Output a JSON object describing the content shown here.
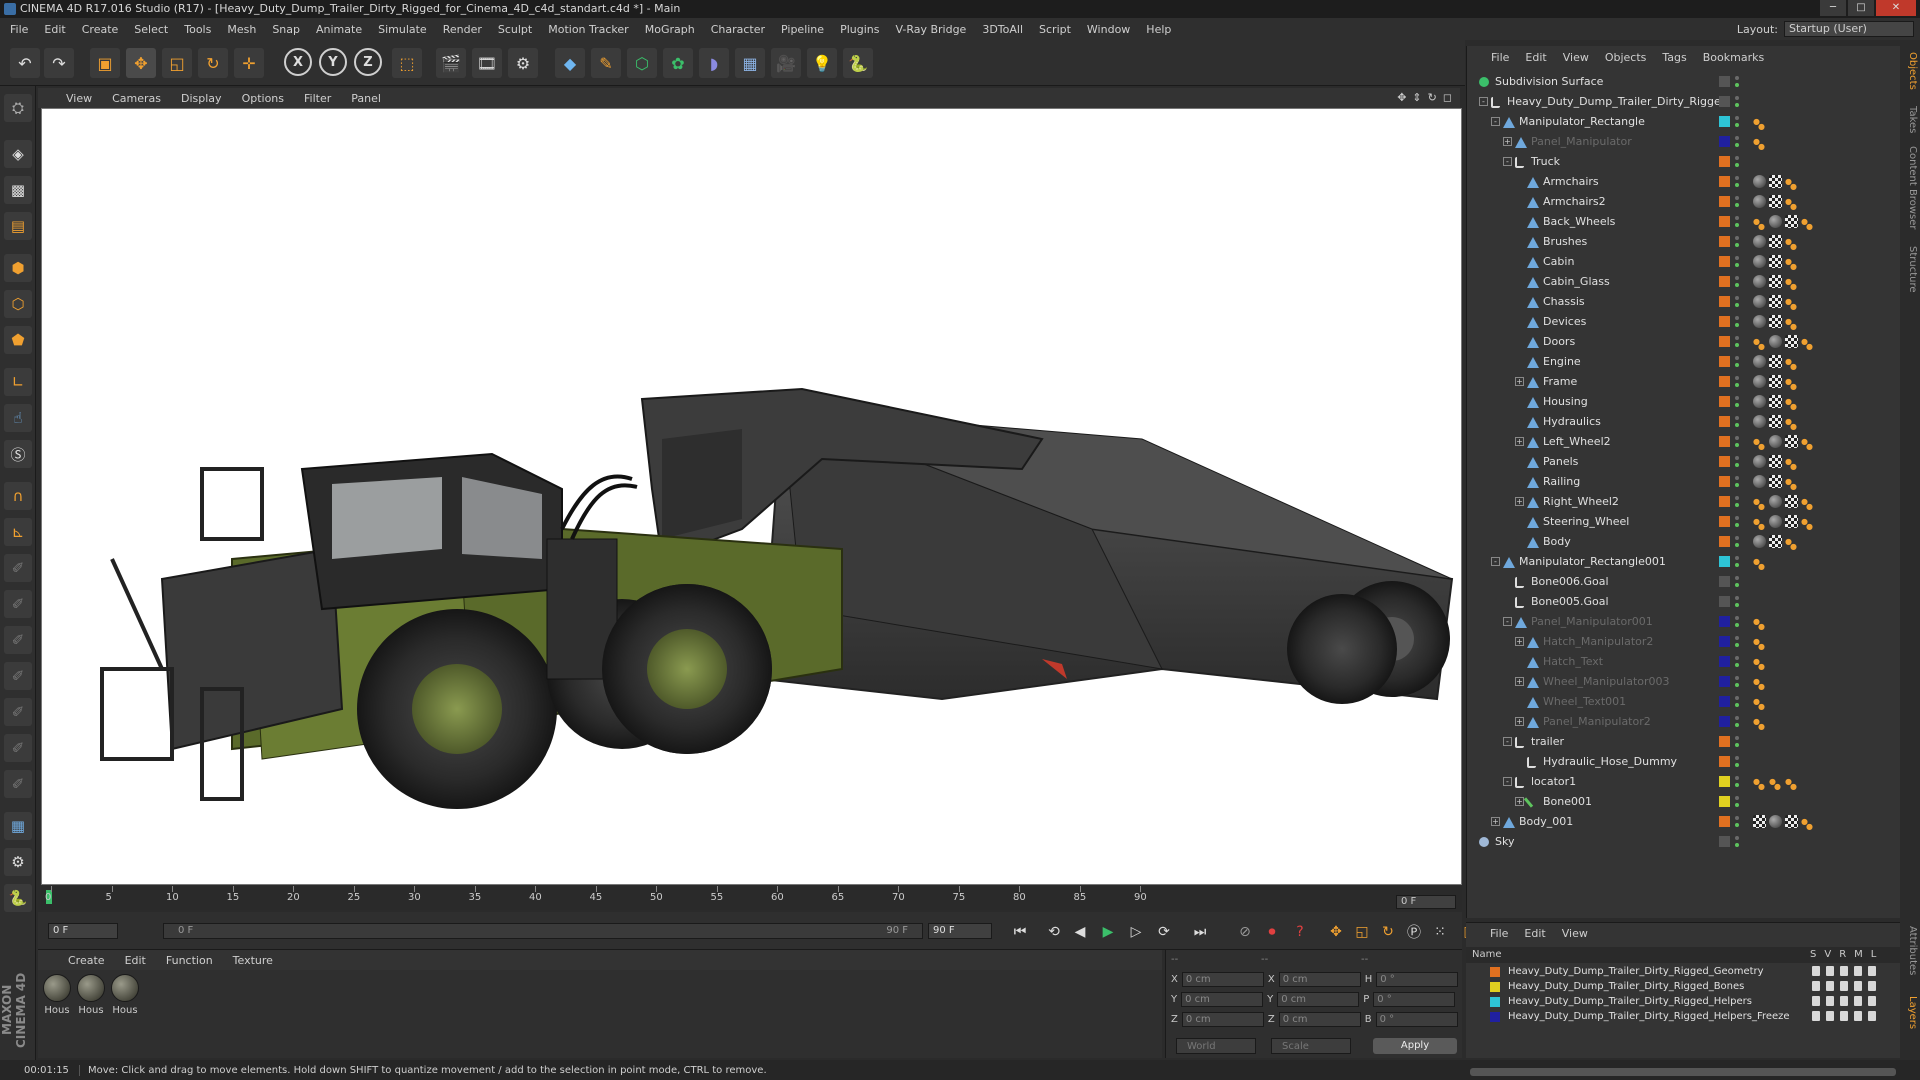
{
  "window": {
    "title": "CINEMA 4D R17.016 Studio (R17) - [Heavy_Duty_Dump_Trailer_Dirty_Rigged_for_Cinema_4D_c4d_standart.c4d *] - Main"
  },
  "menubar": {
    "items": [
      "File",
      "Edit",
      "Create",
      "Select",
      "Tools",
      "Mesh",
      "Snap",
      "Animate",
      "Simulate",
      "Render",
      "Sculpt",
      "Motion Tracker",
      "MoGraph",
      "Character",
      "Pipeline",
      "Plugins",
      "V-Ray Bridge",
      "3DToAll",
      "Script",
      "Window",
      "Help"
    ],
    "layout_label": "Layout:",
    "layout_value": "Startup (User)"
  },
  "toolbar": {
    "axis_x": "X",
    "axis_y": "Y",
    "axis_z": "Z"
  },
  "viewport": {
    "menu": [
      "View",
      "Cameras",
      "Display",
      "Options",
      "Filter",
      "Panel"
    ]
  },
  "timeline": {
    "ticks": [
      "0",
      "5",
      "10",
      "15",
      "20",
      "25",
      "30",
      "35",
      "40",
      "45",
      "50",
      "55",
      "60",
      "65",
      "70",
      "75",
      "80",
      "85",
      "90"
    ],
    "current_frame": "0 F"
  },
  "playback": {
    "start_field": "0 F",
    "slider_left": "0 F",
    "slider_right": "90 F",
    "end_field": "90 F"
  },
  "materials": {
    "menu": [
      "Create",
      "Edit",
      "Function",
      "Texture"
    ],
    "items": [
      "Hous",
      "Hous",
      "Hous"
    ]
  },
  "coordinates": {
    "header_left": "--",
    "header_mid": "--",
    "header_right": "--",
    "rows": [
      {
        "a_label": "X",
        "a_val": "0 cm",
        "b_label": "X",
        "b_val": "0 cm",
        "c_label": "H",
        "c_val": "0 °"
      },
      {
        "a_label": "Y",
        "a_val": "0 cm",
        "b_label": "Y",
        "b_val": "0 cm",
        "c_label": "P",
        "c_val": "0 °"
      },
      {
        "a_label": "Z",
        "a_val": "0 cm",
        "b_label": "Z",
        "b_val": "0 cm",
        "c_label": "B",
        "c_val": "0 °"
      }
    ],
    "world": "World",
    "scale": "Scale",
    "apply": "Apply"
  },
  "statusbar": {
    "time": "00:01:15",
    "message": "Move: Click and drag to move elements. Hold down SHIFT to quantize movement / add to the selection in point mode, CTRL to remove."
  },
  "object_manager": {
    "menu": [
      "File",
      "Edit",
      "View",
      "Objects",
      "Tags",
      "Bookmarks"
    ],
    "rows": [
      {
        "name": "Subdivision Surface",
        "depth": 0,
        "icon": "sub",
        "exp": "",
        "layer": "",
        "dim": false,
        "tags": []
      },
      {
        "name": "Heavy_Duty_Dump_Trailer_Dirty_Rigged",
        "depth": 1,
        "icon": "null",
        "exp": "-",
        "layer": "",
        "dim": false,
        "tags": []
      },
      {
        "name": "Manipulator_Rectangle",
        "depth": 2,
        "icon": "poly",
        "exp": "-",
        "layer": "#2ec4d6",
        "dim": false,
        "tags": [
          "dot"
        ]
      },
      {
        "name": "Panel_Manipulator",
        "depth": 3,
        "icon": "poly",
        "exp": "+",
        "layer": "#2020a0",
        "dim": true,
        "tags": [
          "dot"
        ]
      },
      {
        "name": "Truck",
        "depth": 3,
        "icon": "null",
        "exp": "-",
        "layer": "#e07020",
        "dim": false,
        "tags": []
      },
      {
        "name": "Armchairs",
        "depth": 4,
        "icon": "poly",
        "exp": "",
        "layer": "#e07020",
        "dim": false,
        "tags": [
          "mat",
          "chk",
          "dot"
        ]
      },
      {
        "name": "Armchairs2",
        "depth": 4,
        "icon": "poly",
        "exp": "",
        "layer": "#e07020",
        "dim": false,
        "tags": [
          "mat",
          "chk",
          "dot"
        ]
      },
      {
        "name": "Back_Wheels",
        "depth": 4,
        "icon": "poly",
        "exp": "",
        "layer": "#e07020",
        "dim": false,
        "tags": [
          "dot",
          "mat",
          "chk",
          "dot"
        ]
      },
      {
        "name": "Brushes",
        "depth": 4,
        "icon": "poly",
        "exp": "",
        "layer": "#e07020",
        "dim": false,
        "tags": [
          "mat",
          "chk",
          "dot"
        ]
      },
      {
        "name": "Cabin",
        "depth": 4,
        "icon": "poly",
        "exp": "",
        "layer": "#e07020",
        "dim": false,
        "tags": [
          "mat",
          "chk",
          "dot"
        ]
      },
      {
        "name": "Cabin_Glass",
        "depth": 4,
        "icon": "poly",
        "exp": "",
        "layer": "#e07020",
        "dim": false,
        "tags": [
          "mat",
          "chk",
          "dot"
        ]
      },
      {
        "name": "Chassis",
        "depth": 4,
        "icon": "poly",
        "exp": "",
        "layer": "#e07020",
        "dim": false,
        "tags": [
          "mat",
          "chk",
          "dot"
        ]
      },
      {
        "name": "Devices",
        "depth": 4,
        "icon": "poly",
        "exp": "",
        "layer": "#e07020",
        "dim": false,
        "tags": [
          "mat",
          "chk",
          "dot"
        ]
      },
      {
        "name": "Doors",
        "depth": 4,
        "icon": "poly",
        "exp": "",
        "layer": "#e07020",
        "dim": false,
        "tags": [
          "dot",
          "mat",
          "chk",
          "dot"
        ]
      },
      {
        "name": "Engine",
        "depth": 4,
        "icon": "poly",
        "exp": "",
        "layer": "#e07020",
        "dim": false,
        "tags": [
          "mat",
          "chk",
          "dot"
        ]
      },
      {
        "name": "Frame",
        "depth": 4,
        "icon": "poly",
        "exp": "+",
        "layer": "#e07020",
        "dim": false,
        "tags": [
          "mat",
          "chk",
          "dot"
        ]
      },
      {
        "name": "Housing",
        "depth": 4,
        "icon": "poly",
        "exp": "",
        "layer": "#e07020",
        "dim": false,
        "tags": [
          "mat",
          "chk",
          "dot"
        ]
      },
      {
        "name": "Hydraulics",
        "depth": 4,
        "icon": "poly",
        "exp": "",
        "layer": "#e07020",
        "dim": false,
        "tags": [
          "mat",
          "chk",
          "dot"
        ]
      },
      {
        "name": "Left_Wheel2",
        "depth": 4,
        "icon": "poly",
        "exp": "+",
        "layer": "#e07020",
        "dim": false,
        "tags": [
          "dot",
          "mat",
          "chk",
          "dot"
        ]
      },
      {
        "name": "Panels",
        "depth": 4,
        "icon": "poly",
        "exp": "",
        "layer": "#e07020",
        "dim": false,
        "tags": [
          "mat",
          "chk",
          "dot"
        ]
      },
      {
        "name": "Railing",
        "depth": 4,
        "icon": "poly",
        "exp": "",
        "layer": "#e07020",
        "dim": false,
        "tags": [
          "mat",
          "chk",
          "dot"
        ]
      },
      {
        "name": "Right_Wheel2",
        "depth": 4,
        "icon": "poly",
        "exp": "+",
        "layer": "#e07020",
        "dim": false,
        "tags": [
          "dot",
          "mat",
          "chk",
          "dot"
        ]
      },
      {
        "name": "Steering_Wheel",
        "depth": 4,
        "icon": "poly",
        "exp": "",
        "layer": "#e07020",
        "dim": false,
        "tags": [
          "dot",
          "mat",
          "chk",
          "dot"
        ]
      },
      {
        "name": "Body",
        "depth": 4,
        "icon": "poly",
        "exp": "",
        "layer": "#e07020",
        "dim": false,
        "tags": [
          "mat",
          "chk",
          "dot"
        ]
      },
      {
        "name": "Manipulator_Rectangle001",
        "depth": 2,
        "icon": "poly",
        "exp": "-",
        "layer": "#2ec4d6",
        "dim": false,
        "tags": [
          "dot"
        ]
      },
      {
        "name": "Bone006.Goal",
        "depth": 3,
        "icon": "null",
        "exp": "",
        "layer": "",
        "dim": false,
        "tags": []
      },
      {
        "name": "Bone005.Goal",
        "depth": 3,
        "icon": "null",
        "exp": "",
        "layer": "",
        "dim": false,
        "tags": []
      },
      {
        "name": "Panel_Manipulator001",
        "depth": 3,
        "icon": "poly",
        "exp": "-",
        "layer": "#2020a0",
        "dim": true,
        "tags": [
          "dot"
        ]
      },
      {
        "name": "Hatch_Manipulator2",
        "depth": 4,
        "icon": "poly",
        "exp": "+",
        "layer": "#2020a0",
        "dim": true,
        "tags": [
          "dot"
        ]
      },
      {
        "name": "Hatch_Text",
        "depth": 4,
        "icon": "poly",
        "exp": "",
        "layer": "#2020a0",
        "dim": true,
        "tags": [
          "dot"
        ]
      },
      {
        "name": "Wheel_Manipulator003",
        "depth": 4,
        "icon": "poly",
        "exp": "+",
        "layer": "#2020a0",
        "dim": true,
        "tags": [
          "dot"
        ]
      },
      {
        "name": "Wheel_Text001",
        "depth": 4,
        "icon": "poly",
        "exp": "",
        "layer": "#2020a0",
        "dim": true,
        "tags": [
          "dot"
        ]
      },
      {
        "name": "Panel_Manipulator2",
        "depth": 4,
        "icon": "poly",
        "exp": "+",
        "layer": "#2020a0",
        "dim": true,
        "tags": [
          "dot"
        ]
      },
      {
        "name": "trailer",
        "depth": 3,
        "icon": "null",
        "exp": "-",
        "layer": "#e07020",
        "dim": false,
        "tags": []
      },
      {
        "name": "Hydraulic_Hose_Dummy",
        "depth": 4,
        "icon": "null",
        "exp": "",
        "layer": "#e07020",
        "dim": false,
        "tags": []
      },
      {
        "name": "locator1",
        "depth": 3,
        "icon": "null",
        "exp": "-",
        "layer": "#e0d020",
        "dim": false,
        "tags": [
          "dot",
          "dot",
          "dot"
        ]
      },
      {
        "name": "Bone001",
        "depth": 4,
        "icon": "bone",
        "exp": "+",
        "layer": "#e0d020",
        "dim": false,
        "tags": []
      },
      {
        "name": "Body_001",
        "depth": 2,
        "icon": "poly",
        "exp": "+",
        "layer": "#e07020",
        "dim": false,
        "tags": [
          "chk",
          "mat",
          "chk",
          "dot"
        ]
      },
      {
        "name": "Sky",
        "depth": 0,
        "icon": "sky",
        "exp": "",
        "layer": "",
        "dim": false,
        "tags": []
      }
    ]
  },
  "side_tabs": [
    "Objects",
    "Takes",
    "Content Browser",
    "Structure"
  ],
  "side_tabs_lower": [
    "Attributes",
    "Layers"
  ],
  "layer_manager": {
    "menu": [
      "File",
      "Edit",
      "View"
    ],
    "header_name": "Name",
    "header_flags": [
      "S",
      "V",
      "R",
      "M",
      "L"
    ],
    "layers": [
      {
        "name": "Heavy_Duty_Dump_Trailer_Dirty_Rigged_Geometry",
        "color": "#e07020"
      },
      {
        "name": "Heavy_Duty_Dump_Trailer_Dirty_Rigged_Bones",
        "color": "#e0d020"
      },
      {
        "name": "Heavy_Duty_Dump_Trailer_Dirty_Rigged_Helpers",
        "color": "#2ec4d6"
      },
      {
        "name": "Heavy_Duty_Dump_Trailer_Dirty_Rigged_Helpers_Freeze",
        "color": "#2020a0"
      }
    ]
  },
  "maxon": {
    "line1": "MAXON",
    "line2": "CINEMA 4D"
  }
}
